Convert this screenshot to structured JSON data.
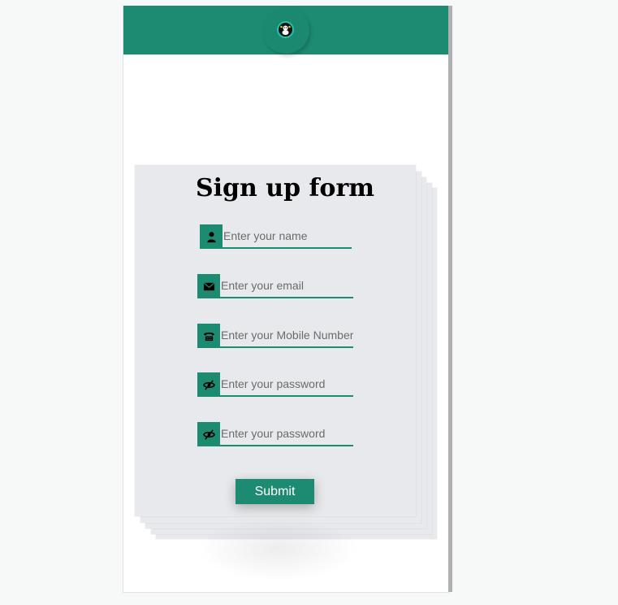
{
  "form": {
    "title": "Sign up form",
    "fields": [
      {
        "icon": "user-icon",
        "placeholder": "Enter your name",
        "value": ""
      },
      {
        "icon": "envelope-icon",
        "placeholder": "Enter your email",
        "value": ""
      },
      {
        "icon": "phone-icon",
        "placeholder": "Enter your Mobile Number",
        "value": ""
      },
      {
        "icon": "eye-slash-icon",
        "placeholder": "Enter your password",
        "value": ""
      },
      {
        "icon": "eye-slash-icon",
        "placeholder": "Enter your password",
        "value": ""
      }
    ],
    "submit_label": "Submit"
  },
  "colors": {
    "accent": "#1d8b72",
    "card_bg": "#e8e9ec",
    "page_bg": "#f7f8f8"
  }
}
